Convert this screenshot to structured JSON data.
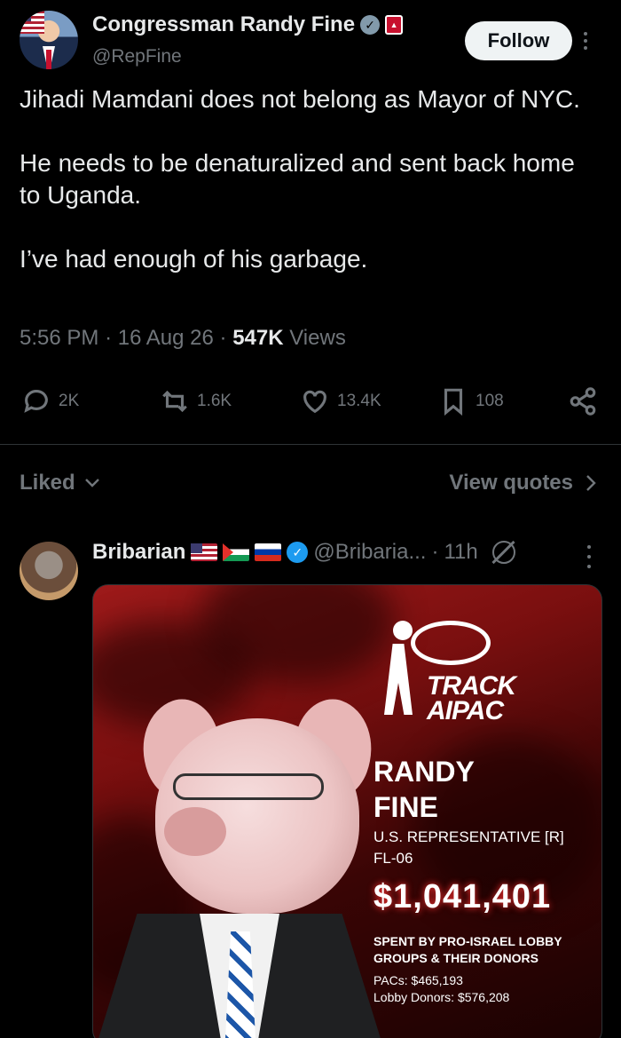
{
  "tweet": {
    "display_name": "Congressman Randy Fine",
    "handle": "@RepFine",
    "follow_label": "Follow",
    "text_paragraphs": [
      "Jihadi Mamdani does not belong as Mayor of NYC.",
      "He needs to be denaturalized and sent back home to Uganda.",
      "I’ve had enough of his garbage."
    ],
    "time": "5:56 PM",
    "date": "16 Aug 26",
    "views_count": "547K",
    "views_label": "Views",
    "replies": "2K",
    "reposts": "1.6K",
    "likes": "13.4K",
    "bookmarks": "108"
  },
  "tabs": {
    "liked_label": "Liked",
    "view_quotes_label": "View quotes"
  },
  "reply": {
    "display_name": "Bribarian",
    "handle": "@Bribaria...",
    "time": "11h",
    "media": {
      "logo_text_line1": "TRACK",
      "logo_text_line2": "AIPAC",
      "name_line1": "RANDY",
      "name_line2": "FINE",
      "title_line1": "U.S. REPRESENTATIVE [R]",
      "title_line2": "FL-06",
      "amount": "$1,041,401",
      "spent_line1": "SPENT BY PRO-ISRAEL LOBBY",
      "spent_line2": "GROUPS & THEIR DONORS",
      "pacs": "PACs: $465,193",
      "lobby_donors": "Lobby Donors: $576,208"
    }
  },
  "icons": {
    "reply": "reply-icon",
    "repost": "repost-icon",
    "like": "heart-icon",
    "bookmark": "bookmark-icon",
    "share": "share-icon",
    "verified": "verified-badge-icon",
    "more": "more-icon"
  }
}
